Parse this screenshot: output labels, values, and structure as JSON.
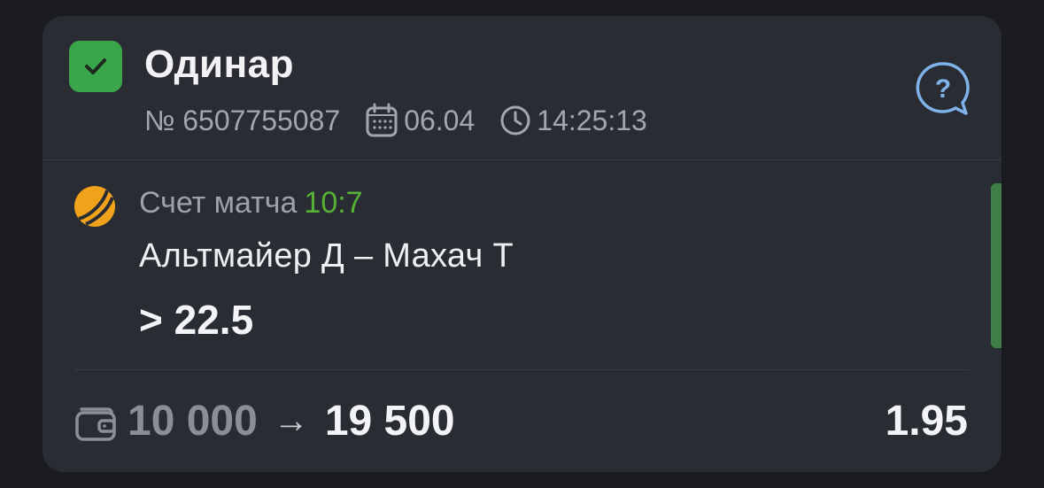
{
  "header": {
    "title": "Одинар",
    "number": "№ 6507755087",
    "date": "06.04",
    "time": "14:25:13",
    "status_icon": "checkmark-icon",
    "status_color": "#3aa64a",
    "help_icon": "question-chat-icon"
  },
  "event": {
    "sport_icon": "tennis-ball-icon",
    "score_label": "Счет матча",
    "score": "10:7",
    "teams": "Альтмайер Д – Махач Т",
    "bet": "> 22.5",
    "result_color": "#3f7f46"
  },
  "footer": {
    "wallet_icon": "wallet-icon",
    "stake": "10 000",
    "arrow": "→",
    "payout": "19 500",
    "odds": "1.95"
  }
}
